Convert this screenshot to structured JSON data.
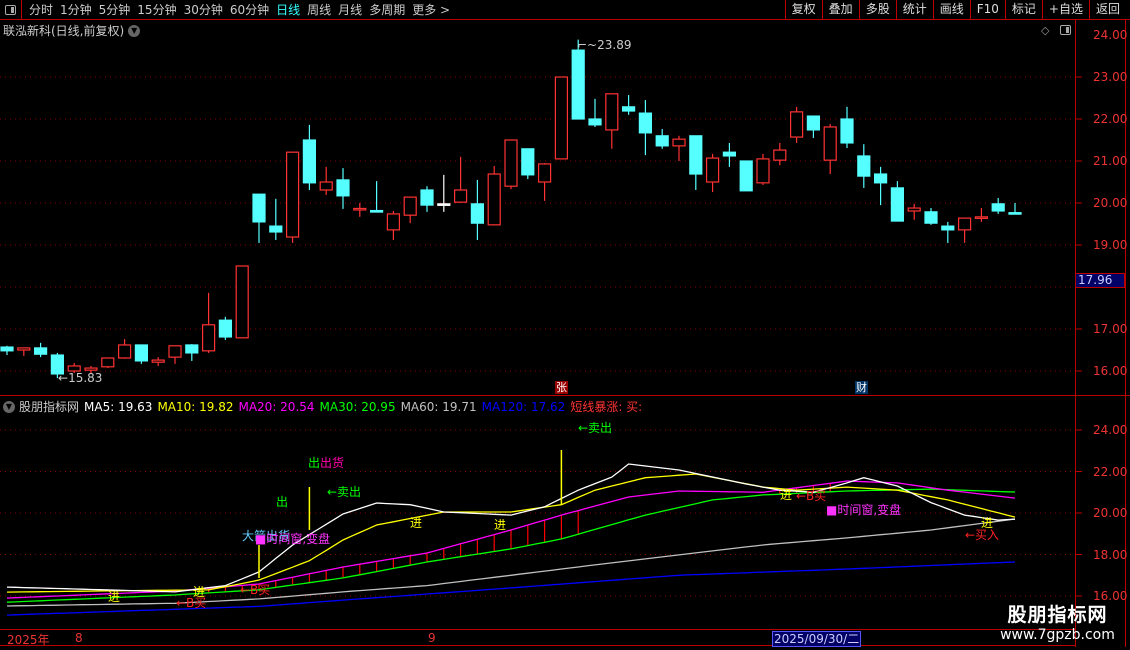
{
  "topbar": {
    "periods": [
      "分时",
      "1分钟",
      "5分钟",
      "15分钟",
      "30分钟",
      "60分钟",
      "日线",
      "周线",
      "月线",
      "多周期",
      "更多 >"
    ],
    "active_period": "日线",
    "buttons": [
      "复权",
      "叠加",
      "多股",
      "统计",
      "画线",
      "F10",
      "标记",
      "+自选",
      "返回"
    ]
  },
  "title": {
    "text": "联泓新科(日线,前复权)"
  },
  "main_axis": {
    "labels": [
      "24.00",
      "23.00",
      "22.00",
      "21.00",
      "20.00",
      "19.00",
      "17.00",
      "16.00"
    ],
    "current_price": "17.96"
  },
  "annotations": {
    "high_label": "23.89",
    "low_label": "15.83",
    "marker_zhang": "张",
    "marker_cai": "财"
  },
  "colors": {
    "up": "#ff3333",
    "down": "#55ffff",
    "grid": "#880000",
    "ma5": "#ffffff",
    "ma10": "#ffff00",
    "ma20": "#ff00ff",
    "ma30": "#00ff00",
    "ma60": "#c0c0c0",
    "ma120": "#0000ff"
  },
  "candles": [
    [
      16.57,
      16.6,
      16.38,
      16.48
    ],
    [
      16.5,
      16.55,
      16.36,
      16.55
    ],
    [
      16.55,
      16.67,
      16.33,
      16.4
    ],
    [
      16.38,
      16.43,
      15.83,
      15.93
    ],
    [
      16.0,
      16.19,
      15.95,
      16.12
    ],
    [
      16.02,
      16.12,
      15.95,
      16.07
    ],
    [
      16.1,
      16.31,
      16.07,
      16.31
    ],
    [
      16.31,
      16.76,
      16.29,
      16.62
    ],
    [
      16.62,
      16.62,
      16.17,
      16.24
    ],
    [
      16.21,
      16.33,
      16.12,
      16.26
    ],
    [
      16.33,
      16.6,
      16.17,
      16.6
    ],
    [
      16.62,
      16.64,
      16.24,
      16.43
    ],
    [
      16.48,
      17.86,
      16.43,
      17.1
    ],
    [
      17.21,
      17.29,
      16.74,
      16.81
    ],
    [
      16.79,
      18.5,
      16.79,
      18.5
    ],
    [
      20.21,
      20.21,
      19.05,
      19.55
    ],
    [
      19.45,
      20.1,
      19.12,
      19.31
    ],
    [
      19.19,
      21.21,
      19.05,
      21.21
    ],
    [
      21.5,
      21.86,
      20.31,
      20.48
    ],
    [
      20.31,
      20.86,
      20.19,
      20.5
    ],
    [
      20.55,
      20.83,
      19.86,
      20.17
    ],
    [
      19.86,
      20.0,
      19.67,
      19.87
    ],
    [
      19.82,
      20.52,
      19.81,
      19.81
    ],
    [
      19.36,
      19.81,
      19.12,
      19.74
    ],
    [
      19.71,
      20.14,
      19.52,
      20.14
    ],
    [
      20.31,
      20.4,
      19.79,
      19.95
    ],
    [
      19.98,
      20.67,
      19.79,
      19.98
    ],
    [
      20.02,
      21.1,
      20.02,
      20.31
    ],
    [
      19.98,
      20.55,
      19.12,
      19.52
    ],
    [
      19.48,
      20.88,
      19.48,
      20.69
    ],
    [
      20.4,
      21.5,
      20.33,
      21.5
    ],
    [
      21.29,
      21.29,
      20.57,
      20.67
    ],
    [
      20.5,
      20.95,
      20.05,
      20.93
    ],
    [
      21.05,
      23.0,
      21.05,
      23.0
    ],
    [
      23.64,
      23.89,
      22.0,
      22.0
    ],
    [
      22.0,
      22.48,
      21.81,
      21.86
    ],
    [
      21.74,
      22.6,
      21.29,
      22.6
    ],
    [
      22.29,
      22.57,
      22.1,
      22.19
    ],
    [
      22.14,
      22.45,
      21.14,
      21.67
    ],
    [
      21.6,
      21.76,
      21.29,
      21.36
    ],
    [
      21.36,
      21.6,
      21.0,
      21.52
    ],
    [
      21.6,
      21.6,
      20.31,
      20.69
    ],
    [
      20.5,
      21.17,
      20.26,
      21.07
    ],
    [
      21.21,
      21.43,
      20.86,
      21.12
    ],
    [
      21.0,
      21.0,
      20.29,
      20.29
    ],
    [
      20.48,
      21.17,
      20.43,
      21.05
    ],
    [
      21.02,
      21.43,
      20.9,
      21.26
    ],
    [
      21.57,
      22.29,
      21.43,
      22.17
    ],
    [
      22.07,
      22.07,
      21.55,
      21.74
    ],
    [
      21.02,
      21.88,
      20.69,
      21.81
    ],
    [
      22.0,
      22.29,
      21.31,
      21.43
    ],
    [
      21.12,
      21.4,
      20.36,
      20.64
    ],
    [
      20.69,
      20.86,
      19.95,
      20.48
    ],
    [
      20.36,
      20.52,
      19.57,
      19.57
    ],
    [
      19.81,
      19.98,
      19.6,
      19.88
    ],
    [
      19.79,
      19.88,
      19.48,
      19.52
    ],
    [
      19.45,
      19.55,
      19.05,
      19.36
    ],
    [
      19.36,
      19.64,
      19.05,
      19.64
    ],
    [
      19.64,
      19.88,
      19.55,
      19.67
    ],
    [
      19.98,
      20.12,
      19.74,
      19.81
    ],
    [
      19.77,
      20.0,
      19.76,
      19.76
    ]
  ],
  "indicator": {
    "name": "股朋指标网",
    "legend": [
      {
        "text": "MA5: 19.63",
        "key": "ma5"
      },
      {
        "text": "MA10: 19.82",
        "key": "ma10"
      },
      {
        "text": "MA20: 20.54",
        "key": "ma20"
      },
      {
        "text": "MA30: 20.95",
        "key": "ma30"
      },
      {
        "text": "MA60: 19.71",
        "key": "ma60"
      },
      {
        "text": "MA120: 17.62",
        "key": "ma120"
      },
      {
        "text": "短线暴涨: 买:",
        "key": "up"
      }
    ],
    "axis_labels": [
      "24.00",
      "22.00",
      "20.00",
      "18.00",
      "16.00"
    ],
    "lines": {
      "ma5": [
        [
          0,
          16.43
        ],
        [
          10,
          16.2
        ],
        [
          13,
          16.5
        ],
        [
          15,
          17.16
        ],
        [
          17,
          18.46
        ],
        [
          20,
          19.95
        ],
        [
          22,
          20.48
        ],
        [
          24,
          20.4
        ],
        [
          26,
          20.05
        ],
        [
          30,
          19.9
        ],
        [
          32,
          20.3
        ],
        [
          34,
          21.1
        ],
        [
          36,
          21.73
        ],
        [
          37,
          22.36
        ],
        [
          40,
          22.07
        ],
        [
          44,
          21.4
        ],
        [
          46,
          21.1
        ],
        [
          48,
          21.0
        ],
        [
          50,
          21.45
        ],
        [
          51,
          21.7
        ],
        [
          53,
          21.3
        ],
        [
          55,
          20.5
        ],
        [
          57,
          19.9
        ],
        [
          59,
          19.66
        ],
        [
          60,
          19.7
        ]
      ],
      "ma10": [
        [
          0,
          16.19
        ],
        [
          12,
          16.3
        ],
        [
          14,
          16.6
        ],
        [
          15,
          16.77
        ],
        [
          18,
          17.7
        ],
        [
          20,
          18.7
        ],
        [
          22,
          19.42
        ],
        [
          26,
          20.05
        ],
        [
          30,
          20.05
        ],
        [
          33,
          20.4
        ],
        [
          35,
          21.1
        ],
        [
          38,
          21.7
        ],
        [
          41,
          21.88
        ],
        [
          45,
          21.25
        ],
        [
          47,
          21.1
        ],
        [
          50,
          21.25
        ],
        [
          53,
          21.1
        ],
        [
          56,
          20.63
        ],
        [
          60,
          19.8
        ]
      ],
      "ma20": [
        [
          0,
          15.9
        ],
        [
          10,
          16.24
        ],
        [
          15,
          16.58
        ],
        [
          20,
          17.4
        ],
        [
          25,
          18.07
        ],
        [
          30,
          19.18
        ],
        [
          33,
          19.9
        ],
        [
          37,
          20.77
        ],
        [
          40,
          21.06
        ],
        [
          45,
          21.0
        ],
        [
          50,
          21.54
        ],
        [
          53,
          21.45
        ],
        [
          56,
          21.1
        ],
        [
          60,
          20.72
        ]
      ],
      "ma30": [
        [
          0,
          15.7
        ],
        [
          10,
          16.05
        ],
        [
          15,
          16.3
        ],
        [
          20,
          16.87
        ],
        [
          25,
          17.64
        ],
        [
          30,
          18.27
        ],
        [
          33,
          18.75
        ],
        [
          38,
          19.9
        ],
        [
          42,
          20.63
        ],
        [
          45,
          20.87
        ],
        [
          50,
          21.06
        ],
        [
          55,
          21.15
        ],
        [
          60,
          21.01
        ]
      ],
      "ma60": [
        [
          0,
          15.52
        ],
        [
          10,
          15.65
        ],
        [
          15,
          15.86
        ],
        [
          20,
          16.2
        ],
        [
          25,
          16.5
        ],
        [
          30,
          17.0
        ],
        [
          35,
          17.5
        ],
        [
          40,
          17.98
        ],
        [
          45,
          18.46
        ],
        [
          50,
          18.8
        ],
        [
          55,
          19.18
        ],
        [
          60,
          19.71
        ]
      ],
      "ma120": [
        [
          0,
          15.08
        ],
        [
          15,
          15.5
        ],
        [
          20,
          15.8
        ],
        [
          30,
          16.39
        ],
        [
          40,
          17.0
        ],
        [
          50,
          17.3
        ],
        [
          60,
          17.64
        ]
      ]
    },
    "signals": {
      "sell1": "←卖出",
      "chu_green": "出",
      "chuhuo": "出货",
      "chu": "出",
      "sell2": "←卖出",
      "jin": "进",
      "dajian": "大箭出货",
      "window": "■时间窗,变盘",
      "bbuy": "←B买",
      "buyin": "←买入"
    }
  },
  "date_axis": {
    "year": "2025年",
    "m8": "8",
    "m9": "9",
    "selected": "2025/09/30/二"
  },
  "watermark": {
    "name": "股朋指标网",
    "url": "www.7gpzb.com"
  }
}
